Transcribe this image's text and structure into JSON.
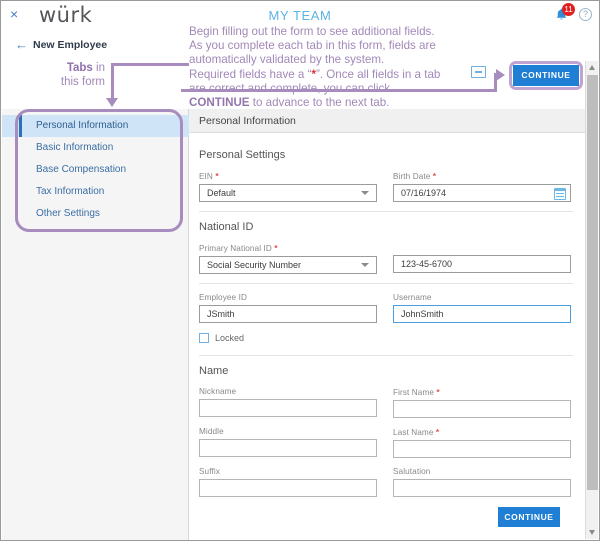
{
  "window": {
    "close_label": "×",
    "brand": "würk",
    "page_title": "MY TEAM",
    "notification_count": "11",
    "help_label": "?"
  },
  "subheader": {
    "back_arrow": "←",
    "back_label": "New Employee"
  },
  "annotations": {
    "tabs_note_bold": "Tabs",
    "tabs_note_rest": " in",
    "tabs_note_line2": "this form",
    "instructions": {
      "line1": "Begin filling out the form to see additional fields.",
      "line2": "As you complete each tab in this form, fields are",
      "line3": "automatically validated by the system.",
      "line4_a": "Required fields have a “",
      "line4_star": "*",
      "line4_b": "”. Once all fields in a tab",
      "line5": "are correct and complete, you can click",
      "line6_bold": "CONTINUE",
      "line6_rest": " to advance to the next tab."
    }
  },
  "sidebar": {
    "tabs": [
      {
        "label": "Personal Information",
        "active": true
      },
      {
        "label": "Basic Information",
        "active": false
      },
      {
        "label": "Base Compensation",
        "active": false
      },
      {
        "label": "Tax Information",
        "active": false
      },
      {
        "label": "Other Settings",
        "active": false
      }
    ]
  },
  "form": {
    "header": "Personal Information",
    "sections": [
      {
        "title": "Personal Settings",
        "rows": [
          [
            {
              "label": "EIN",
              "required": true,
              "value": "Default",
              "control": "select"
            },
            {
              "label": "Birth Date",
              "required": true,
              "value": "07/16/1974",
              "control": "date"
            }
          ]
        ]
      },
      {
        "title": "National ID",
        "rows": [
          [
            {
              "label": "Primary National ID",
              "required": true,
              "value": "Social Security Number",
              "control": "select"
            },
            {
              "label": "",
              "required": false,
              "value": "123-45-6700",
              "control": "text"
            }
          ]
        ]
      },
      {
        "title": "",
        "rows": [
          [
            {
              "label": "Employee ID",
              "required": false,
              "value": "JSmith",
              "control": "text"
            },
            {
              "label": "Username",
              "required": false,
              "value": "JohnSmith",
              "control": "text",
              "focused": true
            }
          ]
        ]
      },
      {
        "title": "Name",
        "rows": [
          [
            {
              "label": "Nickname",
              "required": false,
              "value": "",
              "control": "text"
            },
            {
              "label": "First Name",
              "required": true,
              "value": "",
              "control": "text"
            }
          ],
          [
            {
              "label": "Middle",
              "required": false,
              "value": "",
              "control": "text"
            },
            {
              "label": "Last Name",
              "required": true,
              "value": "",
              "control": "text"
            }
          ],
          [
            {
              "label": "Suffix",
              "required": false,
              "value": "",
              "control": "text"
            },
            {
              "label": "Salutation",
              "required": false,
              "value": "",
              "control": "text"
            }
          ]
        ]
      }
    ],
    "locked_checkbox_label": "Locked",
    "locked_checked": false
  },
  "buttons": {
    "continue_top": "CONTINUE",
    "continue_bottom": "CONTINUE"
  },
  "colors": {
    "accent_blue": "#1e7fd4",
    "annotation_purple": "#a78cbd",
    "title_blue": "#5cb2e6",
    "required_red": "#e03030",
    "active_tab_bg": "#cfe5f7"
  }
}
